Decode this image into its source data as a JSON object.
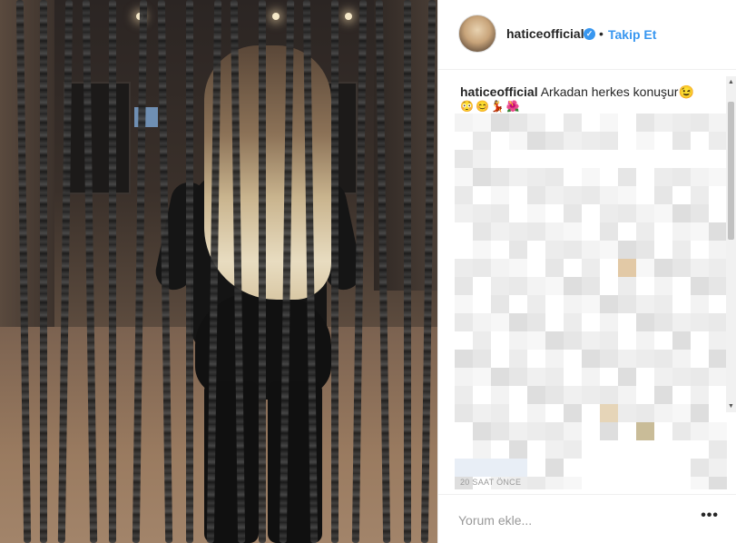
{
  "post": {
    "username": "haticeofficial",
    "verified_icon": "verified-badge-icon",
    "separator": "•",
    "follow_label": "Takip Et",
    "caption_username": "haticeofficial",
    "caption_text": "Arkadan herkes konuşur",
    "caption_emoji": "😉",
    "emoji_line": "😳😊💃🌺",
    "timestamp": "20 SAAT ÖNCE",
    "comment_placeholder": "Yorum ekle...",
    "more_label": "•••"
  },
  "colors": {
    "accent": "#3897f0",
    "text": "#262626",
    "muted": "#999999",
    "border": "#efefef"
  },
  "icons": {
    "verified": "verified-badge-icon",
    "more": "more-options-icon",
    "scroll_up": "scroll-up-arrow-icon",
    "scroll_down": "scroll-down-arrow-icon"
  }
}
